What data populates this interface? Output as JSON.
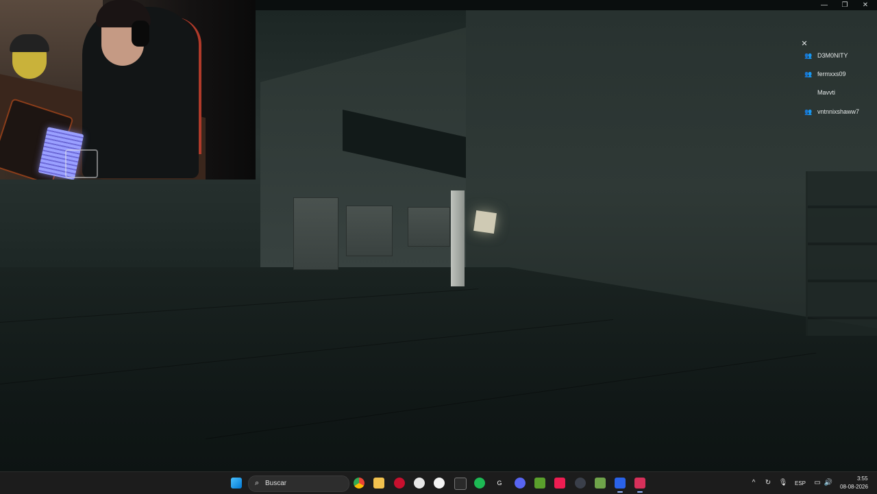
{
  "friends_panel": {
    "close_icon": "close-icon",
    "friends": [
      {
        "name": "D3M0NITY",
        "icon": "group-icon"
      },
      {
        "name": "fermxxs09",
        "icon": "group-icon"
      },
      {
        "name": "Mavvti",
        "icon": ""
      },
      {
        "name": "vntnnixshaww7",
        "icon": "group-icon"
      }
    ]
  },
  "window_controls": {
    "minimize": "—",
    "maximize": "❐",
    "close": "✕"
  },
  "taskbar": {
    "search_placeholder": "Buscar",
    "pinned_apps": [
      "windows-start",
      "chrome",
      "file-explorer",
      "app-red",
      "clock-app",
      "app-round",
      "epic-games",
      "spotify",
      "logitech-g",
      "discord",
      "minecraft",
      "tiktok",
      "steam",
      "game-app",
      "roblox",
      "roblox-studio"
    ],
    "tray": {
      "language": "ESP",
      "time": "3:55",
      "date": "08-08-2026"
    }
  }
}
